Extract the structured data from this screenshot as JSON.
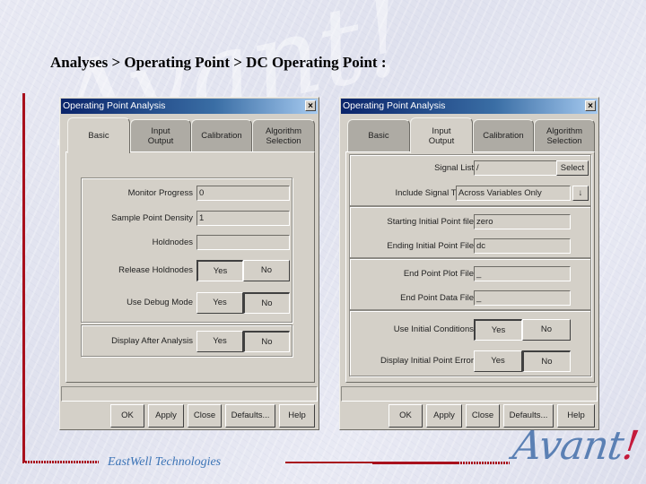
{
  "slide": {
    "title": "Analyses > Operating Point > DC Operating Point :",
    "footer_company": "EastWell Technologies",
    "logo_text": "Avant",
    "logo_bang": "!",
    "watermark": "Avant!",
    "accent_color": "#a8101c"
  },
  "dialogs": [
    {
      "title": "Operating Point Analysis",
      "close_glyph": "×",
      "active_tab": "Basic",
      "tabs": [
        {
          "line1": "Basic",
          "line2": ""
        },
        {
          "line1": "Input",
          "line2": "Output"
        },
        {
          "line1": "Calibration",
          "line2": ""
        },
        {
          "line1": "Algorithm",
          "line2": "Selection"
        }
      ],
      "fields": [
        {
          "label": "Monitor Progress",
          "value": "0"
        },
        {
          "label": "Sample Point Density",
          "value": "1"
        },
        {
          "label": "Holdnodes",
          "value": ""
        }
      ],
      "toggles": [
        {
          "label": "Release Holdnodes",
          "yes": "Yes",
          "no": "No",
          "selected": "Yes"
        },
        {
          "label": "Use Debug Mode",
          "yes": "Yes",
          "no": "No",
          "selected": "No"
        },
        {
          "label": "Display After Analysis",
          "yes": "Yes",
          "no": "No",
          "selected": "No"
        }
      ],
      "buttons": [
        "OK",
        "Apply",
        "Close",
        "Defaults...",
        "Help"
      ]
    },
    {
      "title": "Operating Point Analysis",
      "close_glyph": "×",
      "active_tab": "Input Output",
      "tabs": [
        {
          "line1": "Basic",
          "line2": ""
        },
        {
          "line1": "Input",
          "line2": "Output"
        },
        {
          "line1": "Calibration",
          "line2": ""
        },
        {
          "line1": "Algorithm",
          "line2": "Selection"
        }
      ],
      "signal_list": {
        "label": "Signal List",
        "value": "/",
        "button": "Select"
      },
      "signal_types": {
        "label": "Include Signal Types",
        "value": "Across Variables Only",
        "arrow": "↓"
      },
      "fields": [
        {
          "label": "Starting Initial Point file",
          "value": "zero"
        },
        {
          "label": "Ending Initial Point File",
          "value": "dc"
        },
        {
          "label": "End Point Plot File",
          "value": "_"
        },
        {
          "label": "End Point Data File",
          "value": "_"
        }
      ],
      "toggles": [
        {
          "label": "Use Initial Conditions",
          "yes": "Yes",
          "no": "No",
          "selected": "Yes"
        },
        {
          "label": "Display Initial Point Error",
          "yes": "Yes",
          "no": "No",
          "selected": "No"
        }
      ],
      "buttons": [
        "OK",
        "Apply",
        "Close",
        "Defaults...",
        "Help"
      ]
    }
  ]
}
